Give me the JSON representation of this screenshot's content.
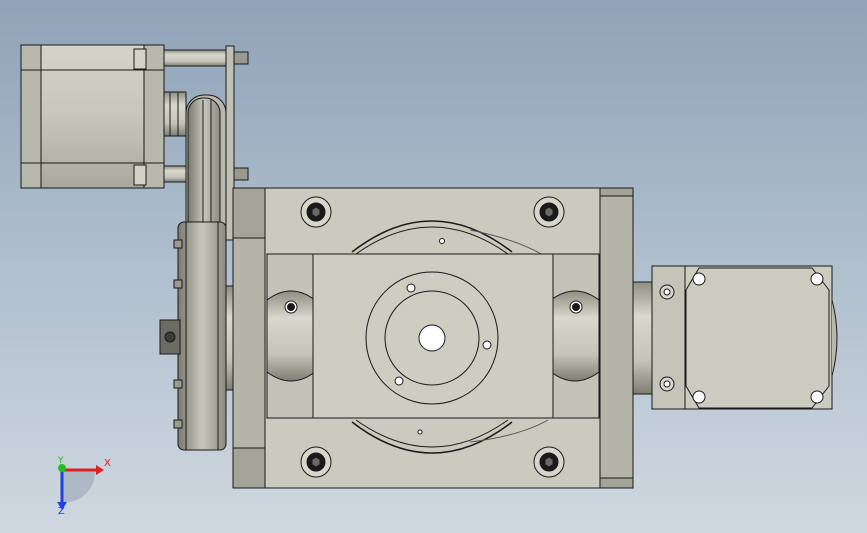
{
  "triad": {
    "x_label": "X",
    "y_label": "Y",
    "z_label": "Z",
    "x_color": "#e02020",
    "y_color": "#20c020",
    "z_color": "#2040e0"
  },
  "colors": {
    "background_top": "#8fa3b8",
    "background_bottom": "#cfd8e0",
    "part_fill": "#c9c9bd",
    "part_shade": "#a9a99d",
    "part_dark": "#8e8e84",
    "edge": "#1a1a1a"
  },
  "icons": [
    "hex-bolt-icon",
    "coordinate-triad-icon"
  ]
}
